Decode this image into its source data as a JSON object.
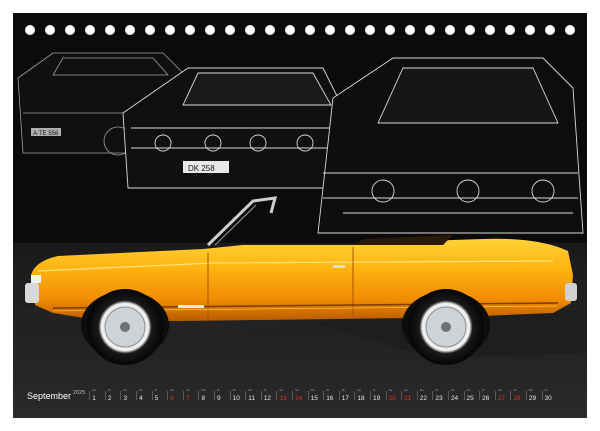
{
  "calendar": {
    "month": "September",
    "year": "2025",
    "weekend_color": "#e0331c",
    "days": [
      {
        "n": "1",
        "w": "Mo"
      },
      {
        "n": "2",
        "w": "Di"
      },
      {
        "n": "3",
        "w": "Mi"
      },
      {
        "n": "4",
        "w": "Do"
      },
      {
        "n": "5",
        "w": "Fr"
      },
      {
        "n": "6",
        "w": "Sa",
        "we": true
      },
      {
        "n": "7",
        "w": "So",
        "we": true
      },
      {
        "n": "8",
        "w": "Mo"
      },
      {
        "n": "9",
        "w": "Di"
      },
      {
        "n": "10",
        "w": "Mi"
      },
      {
        "n": "11",
        "w": "Do"
      },
      {
        "n": "12",
        "w": "Fr"
      },
      {
        "n": "13",
        "w": "Sa",
        "we": true
      },
      {
        "n": "14",
        "w": "So",
        "we": true
      },
      {
        "n": "15",
        "w": "Mo"
      },
      {
        "n": "16",
        "w": "Di"
      },
      {
        "n": "17",
        "w": "Mi"
      },
      {
        "n": "18",
        "w": "Do"
      },
      {
        "n": "19",
        "w": "Fr"
      },
      {
        "n": "20",
        "w": "Sa",
        "we": true
      },
      {
        "n": "21",
        "w": "So",
        "we": true
      },
      {
        "n": "22",
        "w": "Mo"
      },
      {
        "n": "23",
        "w": "Di"
      },
      {
        "n": "24",
        "w": "Mi"
      },
      {
        "n": "25",
        "w": "Do"
      },
      {
        "n": "26",
        "w": "Fr"
      },
      {
        "n": "27",
        "w": "Sa",
        "we": true
      },
      {
        "n": "28",
        "w": "So",
        "we": true
      },
      {
        "n": "29",
        "w": "Mo"
      },
      {
        "n": "30",
        "w": "Di"
      }
    ]
  },
  "colors": {
    "background": "#0b0b0b",
    "car_body": "#f49a05",
    "car_highlight": "#ffc21a"
  },
  "plates": {
    "left": "A·TE 556",
    "center": "DK 258"
  }
}
